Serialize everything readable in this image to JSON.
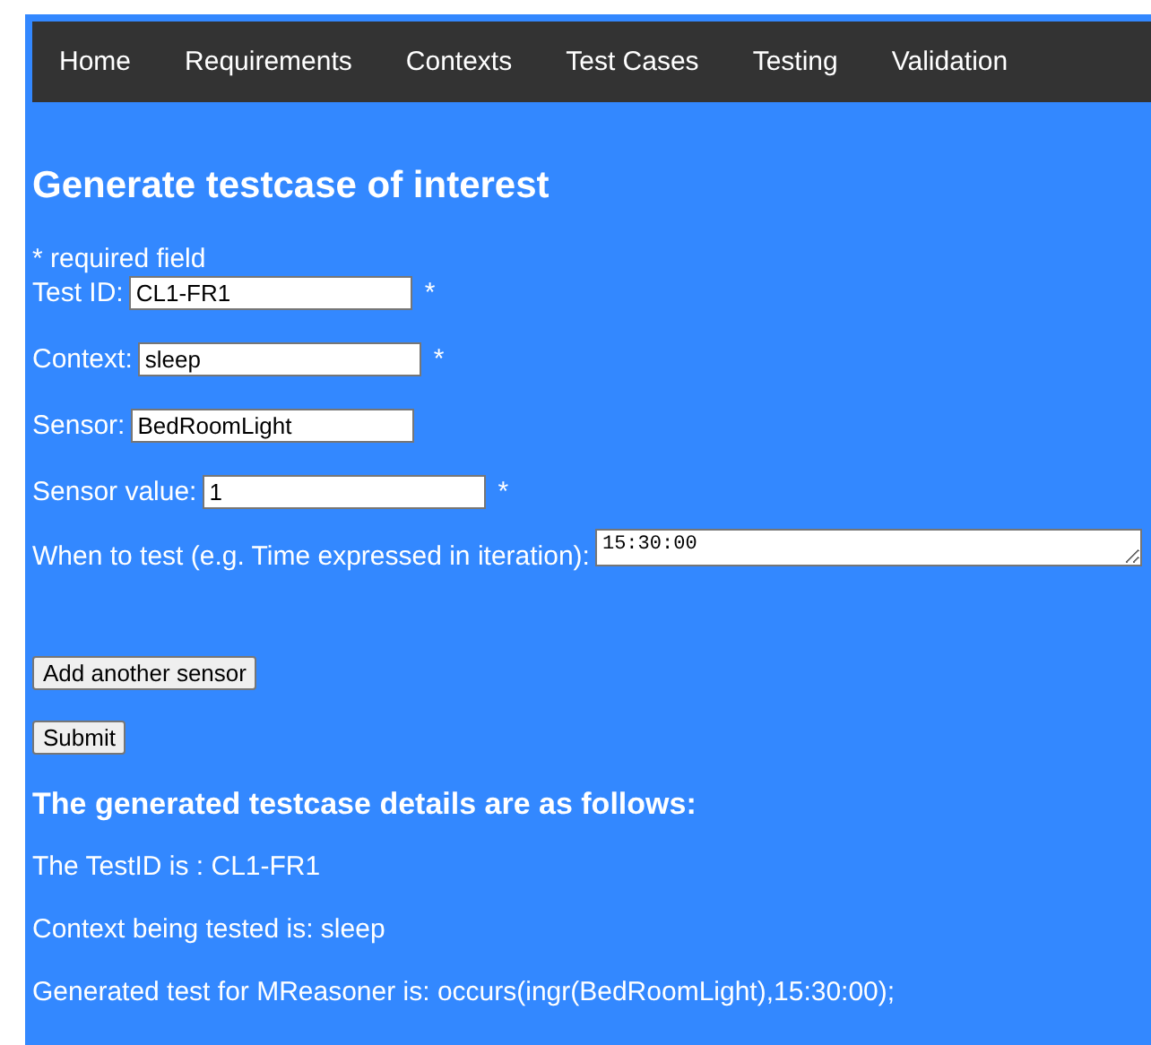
{
  "nav": [
    {
      "label": "Home"
    },
    {
      "label": "Requirements"
    },
    {
      "label": "Contexts"
    },
    {
      "label": "Test Cases"
    },
    {
      "label": "Testing"
    },
    {
      "label": "Validation"
    }
  ],
  "heading": "Generate testcase of interest",
  "required_note": "* required field",
  "fields": [
    {
      "kind": "input",
      "label": "Test ID:",
      "value": "CL1-FR1",
      "required_mark": "*"
    },
    {
      "kind": "input",
      "label": "Context:",
      "value": "sleep",
      "required_mark": "*"
    },
    {
      "kind": "input",
      "label": "Sensor:",
      "value": "BedRoomLight"
    },
    {
      "kind": "input",
      "label": "Sensor value:",
      "value": "1",
      "required_mark": "*"
    },
    {
      "kind": "textarea",
      "label": "When to test (e.g. Time expressed in iteration):",
      "value": "15:30:00"
    }
  ],
  "buttons": [
    "Add another sensor",
    "Submit"
  ],
  "result_heading": "The generated testcase details are as follows:",
  "result_lines": [
    "The TestID is : CL1-FR1",
    "Context being tested is: sleep",
    "Generated test for MReasoner is: occurs(ingr(BedRoomLight),15:30:00);"
  ]
}
